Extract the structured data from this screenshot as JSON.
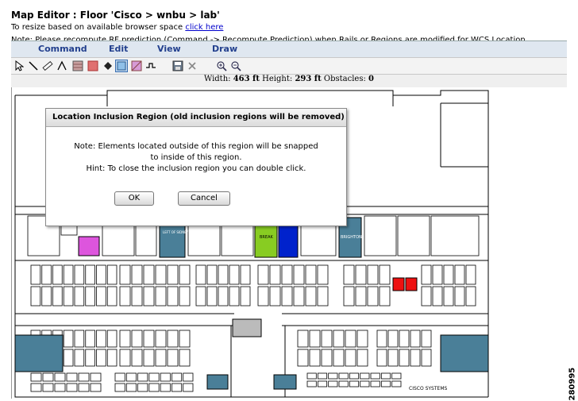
{
  "page": {
    "title": "Map Editor : Floor 'Cisco > wnbu > lab'",
    "resize_prefix": "To resize based on available browser space ",
    "resize_link": "click here",
    "note_text": "Note: Please recompute RF prediction (Command -> Recompute Prediction) when Rails or Regions are modified for WCS Location"
  },
  "menu": [
    {
      "label": "Command"
    },
    {
      "label": "Edit"
    },
    {
      "label": "View"
    },
    {
      "label": "Draw"
    }
  ],
  "toolbar_icons": [
    "select-arrow-icon",
    "line-icon",
    "ruler-icon",
    "perimeter-icon",
    "wall-pattern-icon",
    "coverage-area-icon",
    "diamond-icon",
    "inclusion-region-icon",
    "exclusion-region-icon",
    "rail-icon",
    "save-icon",
    "delete-icon",
    "zoom-in-icon",
    "zoom-out-icon"
  ],
  "dimensions": {
    "width_label": "Width:",
    "width_value": "463 ft",
    "height_label": "Height:",
    "height_value": "293 ft",
    "obstacles_label": "Obstacles:",
    "obstacles_value": "0"
  },
  "dialog": {
    "title": "Location Inclusion Region (old inclusion regions will be removed)",
    "line1": "Note: Elements located outside of this region will be snapped",
    "line2": "to inside of this region.",
    "line3": "Hint: To close the inclusion region you can double click.",
    "ok_label": "OK",
    "cancel_label": "Cancel"
  },
  "map_labels": {
    "break": "BREAK",
    "brighton": "BRIGHTON",
    "left_of_sidney": "LEFT OF SIDNEY",
    "cisco_systems": "CISCO SYSTEMS"
  },
  "figure_id": "280995",
  "colors": {
    "menubar": "#dfe7f0",
    "room_teal": "#4a7f98",
    "room_green": "#88cc22",
    "room_blue": "#0022cc",
    "room_red": "#ee1111",
    "room_magenta": "#dd55dd"
  }
}
